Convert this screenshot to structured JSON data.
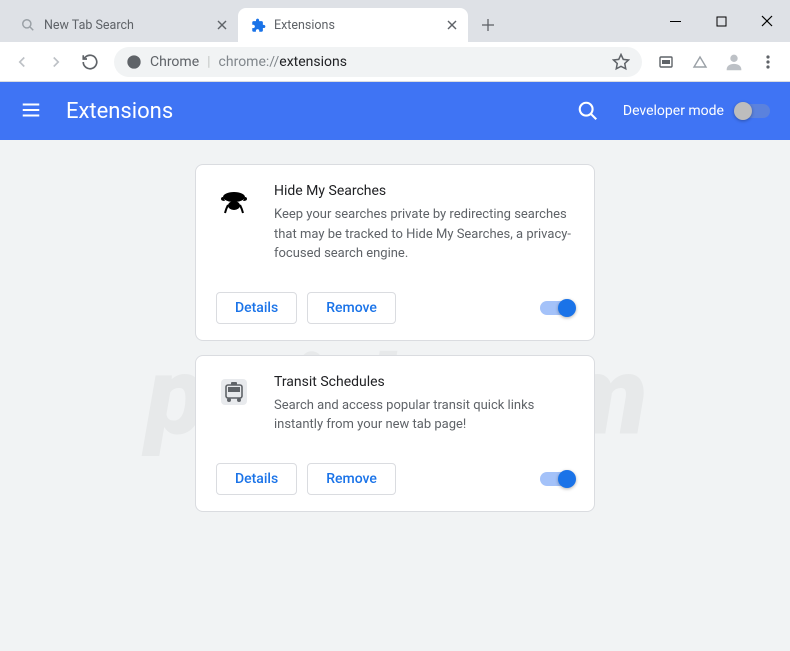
{
  "window": {
    "tabs": [
      {
        "title": "New Tab Search",
        "active": false
      },
      {
        "title": "Extensions",
        "active": true
      }
    ]
  },
  "addressbar": {
    "browser_label": "Chrome",
    "url_scheme": "chrome://",
    "url_path": "extensions"
  },
  "header": {
    "title": "Extensions",
    "dev_mode_label": "Developer mode",
    "dev_mode_on": false
  },
  "extensions": [
    {
      "name": "Hide My Searches",
      "description": "Keep your searches private by redirecting searches that may be tracked to Hide My Searches, a privacy-focused search engine.",
      "enabled": true,
      "icon": "hat"
    },
    {
      "name": "Transit Schedules",
      "description": "Search and access popular transit quick links instantly from your new tab page!",
      "enabled": true,
      "icon": "bus"
    }
  ],
  "buttons": {
    "details": "Details",
    "remove": "Remove"
  },
  "watermark": "pcrisk.com"
}
